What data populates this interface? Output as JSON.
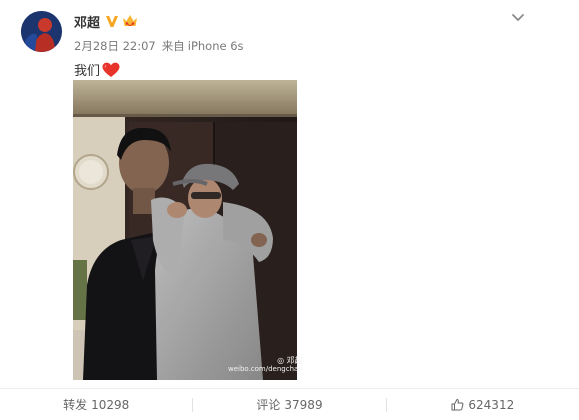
{
  "post": {
    "author": "邓超",
    "date": "2月28日 22:07",
    "source_prefix": "来自",
    "source_device": "iPhone 6s",
    "text": "我们",
    "watermark_handle": "邓超",
    "watermark_url": "weibo.com/dengchao"
  },
  "actions": {
    "repost_label": "转发",
    "repost_count": "10298",
    "comment_label": "评论",
    "comment_count": "37989",
    "like_count": "624312"
  },
  "icons": {
    "verified": "verified-v-badge",
    "vip": "vip-crown-badge",
    "heart": "red-heart-emoji",
    "more": "chevron-down",
    "like": "thumbs-up"
  },
  "colors": {
    "verified": "#f5a623",
    "heart": "#e8332a",
    "meta_text": "#7a7a7a",
    "action_text": "#666666"
  }
}
